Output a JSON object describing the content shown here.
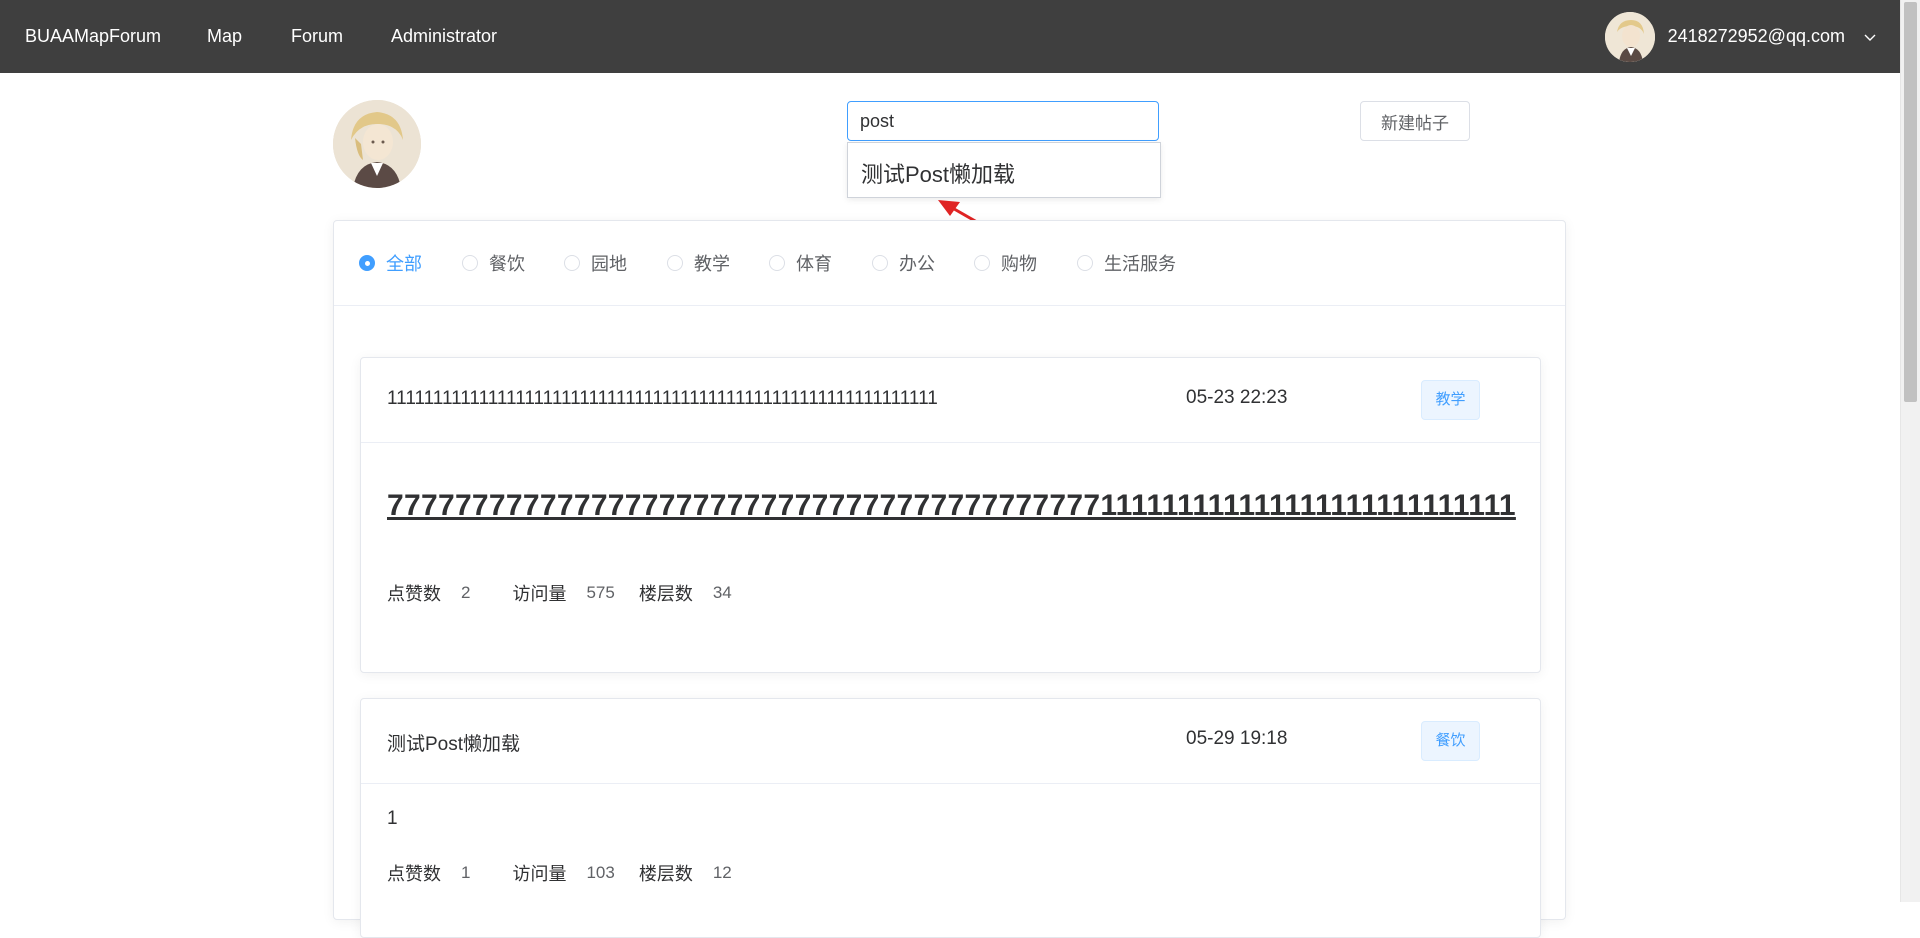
{
  "nav": {
    "brand": "BUAAMapForum",
    "items": [
      "Map",
      "Forum",
      "Administrator"
    ],
    "user_email": "2418272952@qq.com"
  },
  "search": {
    "value": "post",
    "suggestion": "测试Post懒加载"
  },
  "new_post_label": "新建帖子",
  "filters": {
    "options": [
      "全部",
      "餐饮",
      "园地",
      "教学",
      "体育",
      "办公",
      "购物",
      "生活服务"
    ],
    "selected": "全部"
  },
  "labels": {
    "likes": "点赞数",
    "views": "访问量",
    "floors": "楼层数"
  },
  "posts": [
    {
      "title": "111111111111111111111111111111111111111111111111111111111111",
      "date": "05-23 22:23",
      "tag": "教学",
      "content": "777777777777777777777777777777777777777777111111111111111111111111111",
      "likes": "2",
      "views": "575",
      "floors": "34"
    },
    {
      "title": "测试Post懒加载",
      "date": "05-29 19:18",
      "tag": "餐饮",
      "content": "1",
      "likes": "1",
      "views": "103",
      "floors": "12"
    }
  ],
  "colors": {
    "nav_bg": "#3f3f3f",
    "accent": "#409eff",
    "tag_bg": "#ecf5ff",
    "arrow": "#e02424"
  }
}
